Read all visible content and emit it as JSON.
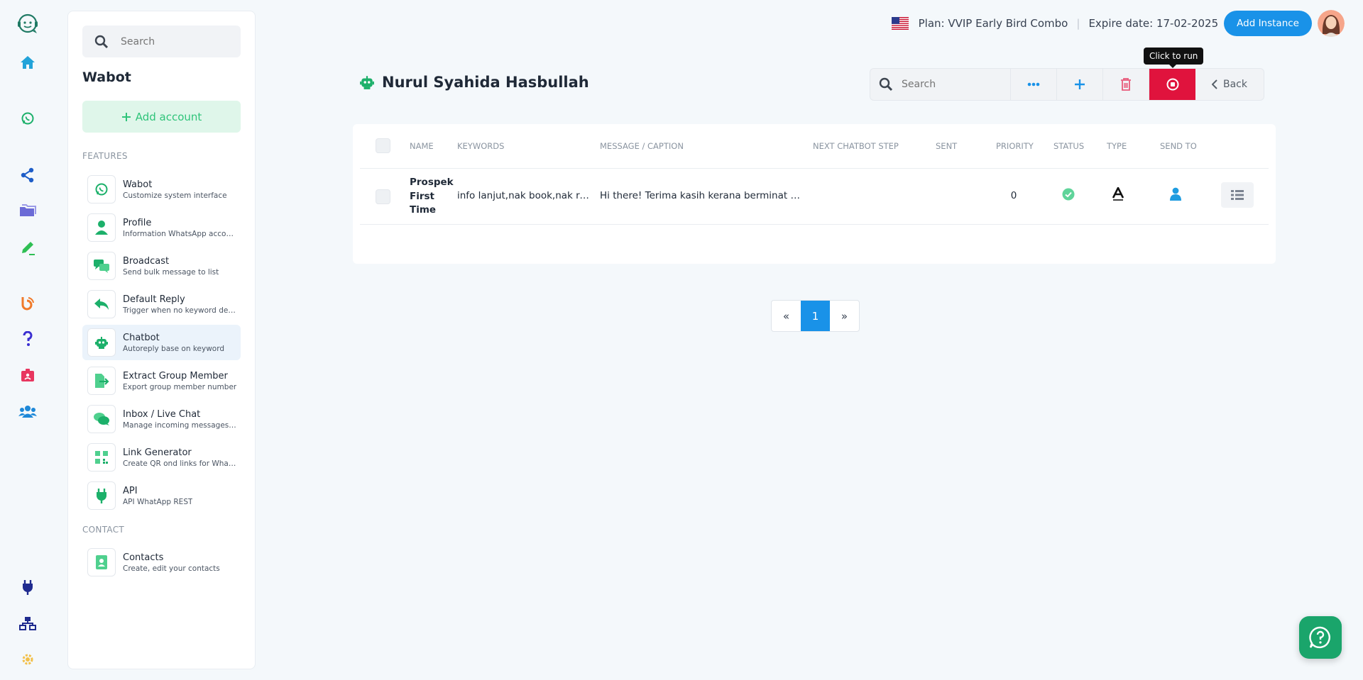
{
  "topbar": {
    "plan": "Plan: VVIP Early Bird Combo",
    "separator": "|",
    "expire": "Expire date: 17-02-2025",
    "add_instance": "Add Instance"
  },
  "sidebar": {
    "search_placeholder": "Search",
    "title": "Wabot",
    "add_account": "Add account",
    "features_label": "FEATURES",
    "contact_label": "CONTACT",
    "items": [
      {
        "title": "Wabot",
        "subtitle": "Customize system interface",
        "icon": "whatsapp-icon"
      },
      {
        "title": "Profile",
        "subtitle": "Information WhatsApp account",
        "icon": "user-icon"
      },
      {
        "title": "Broadcast",
        "subtitle": "Send bulk message to list",
        "icon": "chat-bubbles-icon"
      },
      {
        "title": "Default Reply",
        "subtitle": "Trigger when no keyword dete...",
        "icon": "reply-icon"
      },
      {
        "title": "Chatbot",
        "subtitle": "Autoreply base on keyword",
        "icon": "robot-icon",
        "active": true
      },
      {
        "title": "Extract Group Member",
        "subtitle": "Export group member number",
        "icon": "file-export-icon"
      },
      {
        "title": "Inbox / Live Chat",
        "subtitle": "Manage incoming messages ...",
        "icon": "comments-icon"
      },
      {
        "title": "Link Generator",
        "subtitle": "Create QR ond links for Whats...",
        "icon": "qr-code-icon"
      },
      {
        "title": "API",
        "subtitle": "API WhatApp REST",
        "icon": "plug-icon"
      }
    ],
    "contacts": {
      "title": "Contacts",
      "subtitle": "Create, edit your contacts",
      "icon": "address-book-icon"
    }
  },
  "page": {
    "title": "Nurul Syahida Hasbullah",
    "search_placeholder": "Search",
    "back_label": "Back",
    "tooltip": "Click to run"
  },
  "table": {
    "headers": {
      "name": "NAME",
      "keywords": "KEYWORDS",
      "message": "MESSAGE / CAPTION",
      "next_step": "NEXT CHATBOT STEP",
      "sent": "SENT",
      "priority": "PRIORITY",
      "status": "STATUS",
      "type": "TYPE",
      "send_to": "SEND TO"
    },
    "rows": [
      {
        "name_lines": [
          "Prospek",
          "First",
          "Time"
        ],
        "keywords": "info lanjut,nak book,nak res...",
        "message": "Hi there! Terima kasih kerana berminat de...",
        "next_step": "",
        "sent": "",
        "priority": "0",
        "status": "active",
        "type": "text",
        "send_to": "user"
      }
    ]
  },
  "pagination": {
    "prev": "«",
    "current": "1",
    "next": "»"
  },
  "colors": {
    "accent": "#1992e8",
    "brand_green": "#2fc47a",
    "danger": "#e0133d",
    "icon_green": "#1cb06a"
  }
}
